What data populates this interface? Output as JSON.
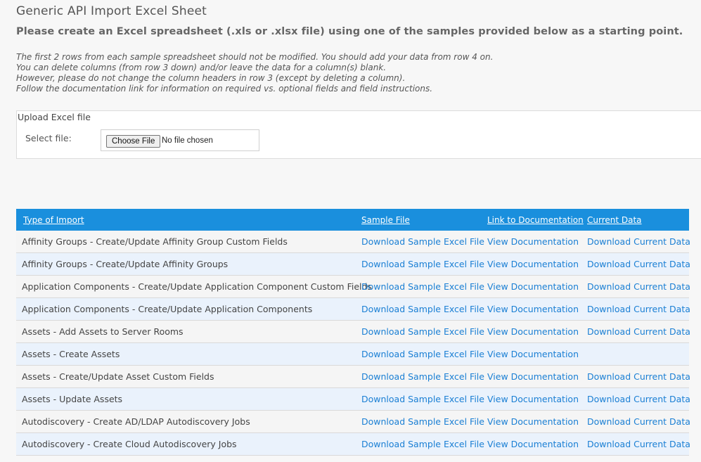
{
  "page": {
    "title": "Generic API Import Excel Sheet",
    "subtitle": "Please create an Excel spreadsheet (.xls or .xlsx file) using one of the samples provided below as a starting point.",
    "instructions": [
      "The first 2 rows from each sample spreadsheet should not be modified. You should add your data from row 4 on.",
      "You can delete columns (from row 3 down) and/or leave the data for a column(s) blank.",
      "However, please do not change the column headers in row 3 (except by deleting a column).",
      "Follow the documentation link for information on required vs. optional fields and field instructions."
    ]
  },
  "upload": {
    "legend": "Upload Excel file",
    "select_label": "Select file:",
    "choose_button": "Choose File",
    "no_file_text": "No file chosen"
  },
  "table": {
    "headers": [
      "Type of Import",
      "Sample File",
      "Link to Documentation",
      "Current Data"
    ],
    "rows": [
      {
        "type": "Affinity Groups - Create/Update Affinity Group Custom Fields",
        "sample": "Download Sample Excel File",
        "docs": "View Documentation",
        "current": "Download Current Data"
      },
      {
        "type": "Affinity Groups - Create/Update Affinity Groups",
        "sample": "Download Sample Excel File",
        "docs": "View Documentation",
        "current": "Download Current Data"
      },
      {
        "type": "Application Components - Create/Update Application Component Custom Fields",
        "sample": "Download Sample Excel File",
        "docs": "View Documentation",
        "current": "Download Current Data"
      },
      {
        "type": "Application Components - Create/Update Application Components",
        "sample": "Download Sample Excel File",
        "docs": "View Documentation",
        "current": "Download Current Data"
      },
      {
        "type": "Assets - Add Assets to Server Rooms",
        "sample": "Download Sample Excel File",
        "docs": "View Documentation",
        "current": "Download Current Data"
      },
      {
        "type": "Assets - Create Assets",
        "sample": "Download Sample Excel File",
        "docs": "View Documentation",
        "current": ""
      },
      {
        "type": "Assets - Create/Update Asset Custom Fields",
        "sample": "Download Sample Excel File",
        "docs": "View Documentation",
        "current": "Download Current Data"
      },
      {
        "type": "Assets - Update Assets",
        "sample": "Download Sample Excel File",
        "docs": "View Documentation",
        "current": "Download Current Data"
      },
      {
        "type": "Autodiscovery - Create AD/LDAP Autodiscovery Jobs",
        "sample": "Download Sample Excel File",
        "docs": "View Documentation",
        "current": "Download Current Data"
      },
      {
        "type": "Autodiscovery - Create Cloud Autodiscovery Jobs",
        "sample": "Download Sample Excel File",
        "docs": "View Documentation",
        "current": "Download Current Data"
      }
    ]
  },
  "colors": {
    "header_bg": "#1a8fdd",
    "link": "#1a7fd4",
    "row_alt": "#eaf2fc"
  }
}
